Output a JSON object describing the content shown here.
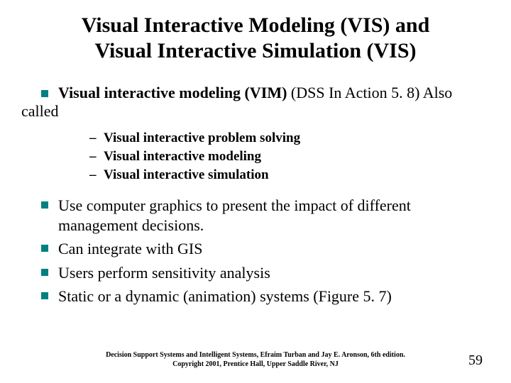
{
  "title_line1": "Visual Interactive Modeling (VIS) and",
  "title_line2": "Visual Interactive Simulation (VIS)",
  "intro_bold": "Visual interactive modeling (VIM)",
  "intro_rest": " (DSS In Action 5. 8) Also called",
  "sub": {
    "a": "Visual interactive problem solving",
    "b": "Visual interactive modeling",
    "c": "Visual interactive simulation"
  },
  "points": {
    "p1": "Use computer graphics to present the impact of different management decisions.",
    "p2": "Can integrate with GIS",
    "p3": "Users perform sensitivity analysis",
    "p4": "Static or a dynamic (animation) systems (Figure 5. 7)"
  },
  "footer_ref_line1": "Decision Support Systems and Intelligent Systems, Efraim Turban and Jay E. Aronson, 6th edition.",
  "footer_ref_line2": "Copyright 2001, Prentice Hall, Upper Saddle River, NJ",
  "page_number": "59"
}
